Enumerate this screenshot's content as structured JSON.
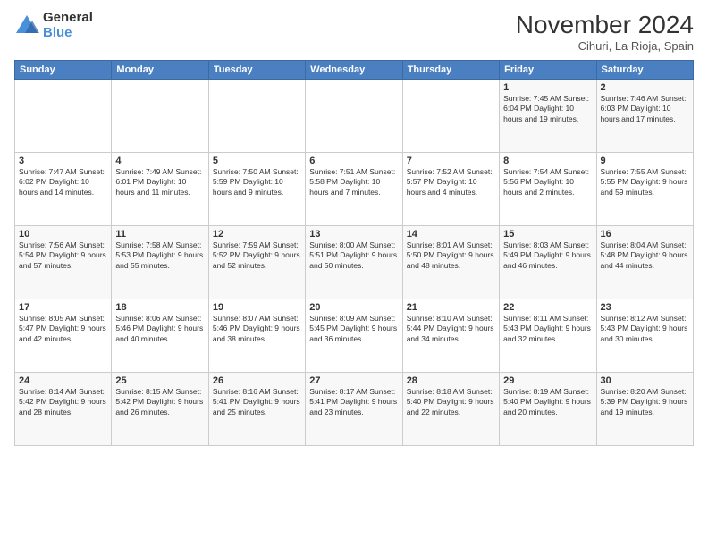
{
  "logo": {
    "general": "General",
    "blue": "Blue"
  },
  "title": "November 2024",
  "location": "Cihuri, La Rioja, Spain",
  "days_header": [
    "Sunday",
    "Monday",
    "Tuesday",
    "Wednesday",
    "Thursday",
    "Friday",
    "Saturday"
  ],
  "weeks": [
    [
      {
        "day": "",
        "info": ""
      },
      {
        "day": "",
        "info": ""
      },
      {
        "day": "",
        "info": ""
      },
      {
        "day": "",
        "info": ""
      },
      {
        "day": "",
        "info": ""
      },
      {
        "day": "1",
        "info": "Sunrise: 7:45 AM\nSunset: 6:04 PM\nDaylight: 10 hours\nand 19 minutes."
      },
      {
        "day": "2",
        "info": "Sunrise: 7:46 AM\nSunset: 6:03 PM\nDaylight: 10 hours\nand 17 minutes."
      }
    ],
    [
      {
        "day": "3",
        "info": "Sunrise: 7:47 AM\nSunset: 6:02 PM\nDaylight: 10 hours\nand 14 minutes."
      },
      {
        "day": "4",
        "info": "Sunrise: 7:49 AM\nSunset: 6:01 PM\nDaylight: 10 hours\nand 11 minutes."
      },
      {
        "day": "5",
        "info": "Sunrise: 7:50 AM\nSunset: 5:59 PM\nDaylight: 10 hours\nand 9 minutes."
      },
      {
        "day": "6",
        "info": "Sunrise: 7:51 AM\nSunset: 5:58 PM\nDaylight: 10 hours\nand 7 minutes."
      },
      {
        "day": "7",
        "info": "Sunrise: 7:52 AM\nSunset: 5:57 PM\nDaylight: 10 hours\nand 4 minutes."
      },
      {
        "day": "8",
        "info": "Sunrise: 7:54 AM\nSunset: 5:56 PM\nDaylight: 10 hours\nand 2 minutes."
      },
      {
        "day": "9",
        "info": "Sunrise: 7:55 AM\nSunset: 5:55 PM\nDaylight: 9 hours\nand 59 minutes."
      }
    ],
    [
      {
        "day": "10",
        "info": "Sunrise: 7:56 AM\nSunset: 5:54 PM\nDaylight: 9 hours\nand 57 minutes."
      },
      {
        "day": "11",
        "info": "Sunrise: 7:58 AM\nSunset: 5:53 PM\nDaylight: 9 hours\nand 55 minutes."
      },
      {
        "day": "12",
        "info": "Sunrise: 7:59 AM\nSunset: 5:52 PM\nDaylight: 9 hours\nand 52 minutes."
      },
      {
        "day": "13",
        "info": "Sunrise: 8:00 AM\nSunset: 5:51 PM\nDaylight: 9 hours\nand 50 minutes."
      },
      {
        "day": "14",
        "info": "Sunrise: 8:01 AM\nSunset: 5:50 PM\nDaylight: 9 hours\nand 48 minutes."
      },
      {
        "day": "15",
        "info": "Sunrise: 8:03 AM\nSunset: 5:49 PM\nDaylight: 9 hours\nand 46 minutes."
      },
      {
        "day": "16",
        "info": "Sunrise: 8:04 AM\nSunset: 5:48 PM\nDaylight: 9 hours\nand 44 minutes."
      }
    ],
    [
      {
        "day": "17",
        "info": "Sunrise: 8:05 AM\nSunset: 5:47 PM\nDaylight: 9 hours\nand 42 minutes."
      },
      {
        "day": "18",
        "info": "Sunrise: 8:06 AM\nSunset: 5:46 PM\nDaylight: 9 hours\nand 40 minutes."
      },
      {
        "day": "19",
        "info": "Sunrise: 8:07 AM\nSunset: 5:46 PM\nDaylight: 9 hours\nand 38 minutes."
      },
      {
        "day": "20",
        "info": "Sunrise: 8:09 AM\nSunset: 5:45 PM\nDaylight: 9 hours\nand 36 minutes."
      },
      {
        "day": "21",
        "info": "Sunrise: 8:10 AM\nSunset: 5:44 PM\nDaylight: 9 hours\nand 34 minutes."
      },
      {
        "day": "22",
        "info": "Sunrise: 8:11 AM\nSunset: 5:43 PM\nDaylight: 9 hours\nand 32 minutes."
      },
      {
        "day": "23",
        "info": "Sunrise: 8:12 AM\nSunset: 5:43 PM\nDaylight: 9 hours\nand 30 minutes."
      }
    ],
    [
      {
        "day": "24",
        "info": "Sunrise: 8:14 AM\nSunset: 5:42 PM\nDaylight: 9 hours\nand 28 minutes."
      },
      {
        "day": "25",
        "info": "Sunrise: 8:15 AM\nSunset: 5:42 PM\nDaylight: 9 hours\nand 26 minutes."
      },
      {
        "day": "26",
        "info": "Sunrise: 8:16 AM\nSunset: 5:41 PM\nDaylight: 9 hours\nand 25 minutes."
      },
      {
        "day": "27",
        "info": "Sunrise: 8:17 AM\nSunset: 5:41 PM\nDaylight: 9 hours\nand 23 minutes."
      },
      {
        "day": "28",
        "info": "Sunrise: 8:18 AM\nSunset: 5:40 PM\nDaylight: 9 hours\nand 22 minutes."
      },
      {
        "day": "29",
        "info": "Sunrise: 8:19 AM\nSunset: 5:40 PM\nDaylight: 9 hours\nand 20 minutes."
      },
      {
        "day": "30",
        "info": "Sunrise: 8:20 AM\nSunset: 5:39 PM\nDaylight: 9 hours\nand 19 minutes."
      }
    ]
  ]
}
